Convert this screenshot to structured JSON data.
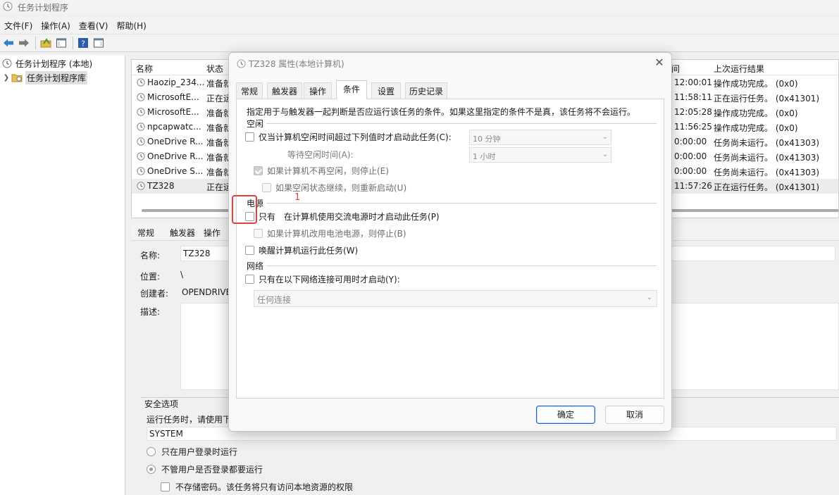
{
  "window": {
    "title": "任务计划程序"
  },
  "menu": [
    "文件(F)",
    "操作(A)",
    "查看(V)",
    "帮助(H)"
  ],
  "tree": {
    "root": "任务计划程序 (本地)",
    "library": "任务计划程序库"
  },
  "list": {
    "headers": {
      "name": "名称",
      "status": "状态",
      "last_run_partial": "间",
      "last_result": "上次运行结果"
    },
    "rows": [
      {
        "name": "Haozip_234...",
        "status": "准备就",
        "last_run": "12:00:01",
        "result": "操作成功完成。 (0x0)"
      },
      {
        "name": "MicrosoftE...",
        "status": "正在运",
        "last_run": "11:58:11",
        "result": "正在运行任务。 (0x41301)"
      },
      {
        "name": "MicrosoftE...",
        "status": "准备就",
        "last_run": "12:05:28",
        "result": "操作成功完成。 (0x0)"
      },
      {
        "name": "npcapwatc...",
        "status": "准备就",
        "last_run": "11:56:25",
        "result": "操作成功完成。 (0x0)"
      },
      {
        "name": "OneDrive R...",
        "status": "准备就",
        "last_run": "0:00:00",
        "result": "任务尚未运行。 (0x41303)"
      },
      {
        "name": "OneDrive R...",
        "status": "准备就",
        "last_run": "0:00:00",
        "result": "任务尚未运行。 (0x41303)"
      },
      {
        "name": "OneDrive S...",
        "status": "准备就",
        "last_run": "0:00:00",
        "result": "任务尚未运行。 (0x41303)"
      },
      {
        "name": "TZ328",
        "status": "正在运",
        "last_run": "11:57:26",
        "result": "正在运行任务。 (0x41301)"
      }
    ]
  },
  "detail": {
    "tabs": [
      "常规",
      "触发器",
      "操作"
    ],
    "name_label": "名称:",
    "name_value": "TZ328",
    "location_label": "位置:",
    "location_value": "\\",
    "author_label": "创建者:",
    "author_value": "OPENDRIVE",
    "desc_label": "描述:",
    "security_title": "安全选项",
    "security_prompt": "运行任务时，请使用下",
    "account": "SYSTEM",
    "radio_logged_on": "只在用户登录时运行",
    "radio_whether": "不管用户是否登录都要运行",
    "no_store_pwd": "不存储密码。该任务将只有访问本地资源的权限"
  },
  "dialog": {
    "title": "TZ328 属性(本地计算机)",
    "tabs": [
      "常规",
      "触发器",
      "操作",
      "条件",
      "设置",
      "历史记录"
    ],
    "active_tab": "条件",
    "description": "指定用于与触发器一起判断是否应运行该任务的条件。如果这里指定的条件不是真，该任务将不会运行。",
    "idle": {
      "section": "空闲",
      "start_only_idle": "仅当计算机空闲时间超过下列值时才启动此任务(C):",
      "idle_duration": "10 分钟",
      "wait_idle_label": "等待空闲时间(A):",
      "wait_idle_value": "1 小时",
      "stop_if_not_idle": "如果计算机不再空闲，则停止(E)",
      "restart_if_idle": "如果空闲状态继续，则重新启动(U)"
    },
    "power": {
      "section": "电源",
      "ac_only": "只有在计算机使用交流电源时才启动此任务(P)",
      "ac_only_visible": "只有",
      "ac_only_rest": "在计算机使用交流电源时才启动此任务(P)",
      "stop_on_battery": "如果计算机改用电池电源，则停止(B)",
      "wake": "唤醒计算机运行此任务(W)"
    },
    "network": {
      "section": "网络",
      "only_if_network": "只有在以下网络连接可用时才启动(Y):",
      "connection": "任何连接"
    },
    "ok": "确定",
    "cancel": "取消"
  },
  "annotation": {
    "number": "1",
    "color": "#e0413c"
  }
}
